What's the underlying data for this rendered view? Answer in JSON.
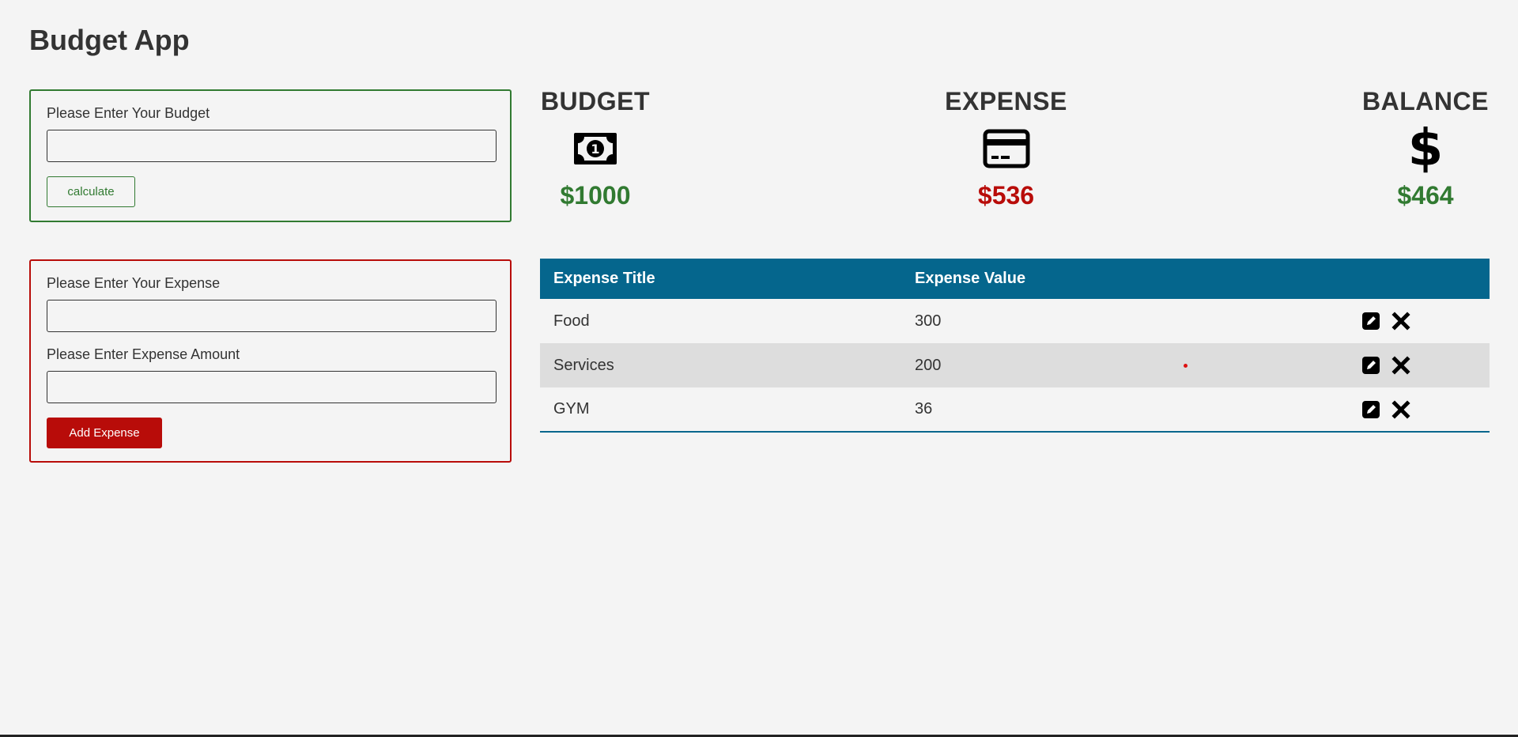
{
  "app": {
    "title": "Budget App"
  },
  "budget_form": {
    "label": "Please Enter Your Budget",
    "value": "",
    "calculate_label": "calculate"
  },
  "expense_form": {
    "title_label": "Please Enter Your Expense",
    "title_value": "",
    "amount_label": "Please Enter Expense Amount",
    "amount_value": "",
    "add_label": "Add Expense"
  },
  "summary": {
    "budget": {
      "heading": "BUDGET",
      "icon": "money-bill-icon",
      "amount": "$1000",
      "color": "#317a31"
    },
    "expense": {
      "heading": "EXPENSE",
      "icon": "credit-card-icon",
      "amount": "$536",
      "color": "#b80c09"
    },
    "balance": {
      "heading": "BALANCE",
      "icon": "dollar-sign-icon",
      "amount": "$464",
      "color": "#317a31"
    }
  },
  "table": {
    "headers": [
      "Expense Title",
      "Expense Value",
      ""
    ],
    "rows": [
      {
        "title": "Food",
        "value": "300",
        "actions": [
          "edit-icon",
          "delete-icon"
        ]
      },
      {
        "title": "Services",
        "value": "200",
        "actions": [
          "edit-icon",
          "delete-icon"
        ]
      },
      {
        "title": "GYM",
        "value": "36",
        "actions": [
          "edit-icon",
          "delete-icon"
        ]
      }
    ],
    "header_color": "#05668d"
  }
}
